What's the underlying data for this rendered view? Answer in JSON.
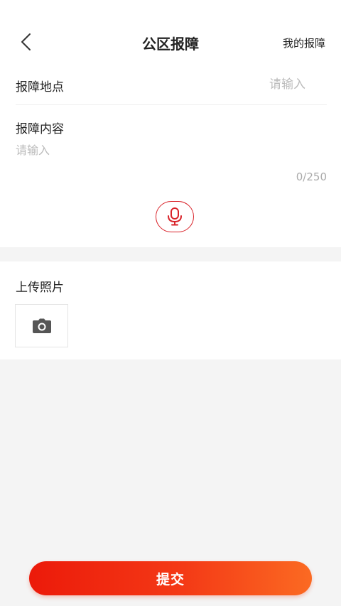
{
  "header": {
    "title": "公区报障",
    "right_link": "我的报障",
    "back_icon": "chevron-left-icon"
  },
  "form": {
    "location": {
      "label": "报障地点",
      "value": "",
      "placeholder": "请输入"
    },
    "content": {
      "label": "报障内容",
      "value": "",
      "placeholder": "请输入",
      "char_count": "0/250"
    },
    "voice_input": {
      "icon": "microphone-icon",
      "color": "#d9232a"
    },
    "photo": {
      "label": "上传照片",
      "icon": "camera-icon"
    }
  },
  "submit": {
    "label": "提交",
    "gradient_start": "#ec1a0a",
    "gradient_end": "#fb6a22"
  }
}
